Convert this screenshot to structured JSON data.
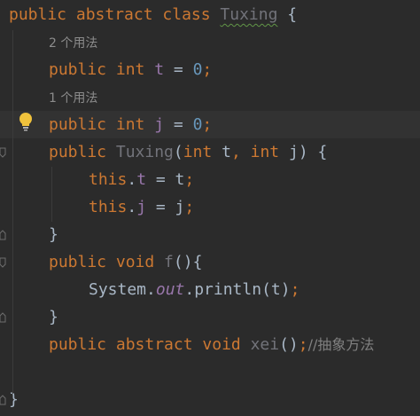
{
  "editor": {
    "lines": [
      {
        "tokens": [
          {
            "t": "public abstract class ",
            "c": "kw"
          },
          {
            "t": "Tuxing",
            "c": "unused squiggle"
          },
          {
            "t": " {",
            "c": ""
          }
        ]
      },
      {
        "hint": "2 个用法"
      },
      {
        "tokens": [
          {
            "t": "public int ",
            "c": "kw"
          },
          {
            "t": "t",
            "c": "field"
          },
          {
            "t": " = ",
            "c": ""
          },
          {
            "t": "0",
            "c": "num"
          },
          {
            "t": ";",
            "c": "kw"
          }
        ]
      },
      {
        "hint": "1 个用法"
      },
      {
        "tokens": [
          {
            "t": "public int ",
            "c": "kw"
          },
          {
            "t": "j",
            "c": "field"
          },
          {
            "t": " = ",
            "c": ""
          },
          {
            "t": "0",
            "c": "num"
          },
          {
            "t": ";",
            "c": "kw"
          }
        ],
        "current": true
      },
      {
        "tokens": [
          {
            "t": "public ",
            "c": "kw"
          },
          {
            "t": "Tuxing",
            "c": "unused"
          },
          {
            "t": "(",
            "c": ""
          },
          {
            "t": "int ",
            "c": "kw"
          },
          {
            "t": "t",
            "c": ""
          },
          {
            "t": ", ",
            "c": "kw"
          },
          {
            "t": "int ",
            "c": "kw"
          },
          {
            "t": "j",
            "c": ""
          },
          {
            "t": ") {",
            "c": ""
          }
        ]
      },
      {
        "tokens": [
          {
            "t": "this",
            "c": "kw"
          },
          {
            "t": ".",
            "c": ""
          },
          {
            "t": "t",
            "c": "field"
          },
          {
            "t": " = t",
            "c": ""
          },
          {
            "t": ";",
            "c": "kw"
          }
        ]
      },
      {
        "tokens": [
          {
            "t": "this",
            "c": "kw"
          },
          {
            "t": ".",
            "c": ""
          },
          {
            "t": "j",
            "c": "field"
          },
          {
            "t": " = j",
            "c": ""
          },
          {
            "t": ";",
            "c": "kw"
          }
        ]
      },
      {
        "tokens": [
          {
            "t": "}",
            "c": ""
          }
        ]
      },
      {
        "tokens": [
          {
            "t": "public void ",
            "c": "kw"
          },
          {
            "t": "f",
            "c": "unused"
          },
          {
            "t": "(){",
            "c": ""
          }
        ]
      },
      {
        "tokens": [
          {
            "t": "System.",
            "c": ""
          },
          {
            "t": "out",
            "c": "italic-field"
          },
          {
            "t": ".println(t)",
            "c": ""
          },
          {
            "t": ";",
            "c": "kw"
          }
        ]
      },
      {
        "tokens": [
          {
            "t": "}",
            "c": ""
          }
        ]
      },
      {
        "tokens": [
          {
            "t": "public abstract void ",
            "c": "kw"
          },
          {
            "t": "xei",
            "c": "unused"
          },
          {
            "t": "()",
            "c": ""
          },
          {
            "t": ";",
            "c": "kw"
          },
          {
            "t": "//抽象方法",
            "c": "comment"
          }
        ]
      },
      {
        "tokens": []
      },
      {
        "tokens": [
          {
            "t": "}",
            "c": ""
          }
        ]
      }
    ],
    "lightbulb_icon": "lightbulb-icon"
  }
}
